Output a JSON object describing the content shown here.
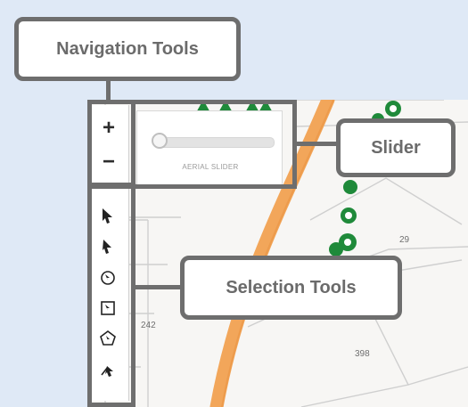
{
  "callouts": {
    "navigation": "Navigation Tools",
    "slider": "Slider",
    "selection": "Selection Tools"
  },
  "toolbar": {
    "zoom_in": "+",
    "zoom_out": "−"
  },
  "slider": {
    "label": "AERIAL SLIDER",
    "value": 0
  },
  "map": {
    "parcel_labels": [
      "29",
      "242",
      "398"
    ],
    "road_color": "#f2a65a",
    "marker_color": "#1f8a3a"
  },
  "icons": {
    "tool1": "select-arrow-icon",
    "tool2": "pointer-icon",
    "tool3": "circle-select-icon",
    "tool4": "rectangle-select-icon",
    "tool5": "polygon-select-icon",
    "tool6": "line-select-icon"
  }
}
